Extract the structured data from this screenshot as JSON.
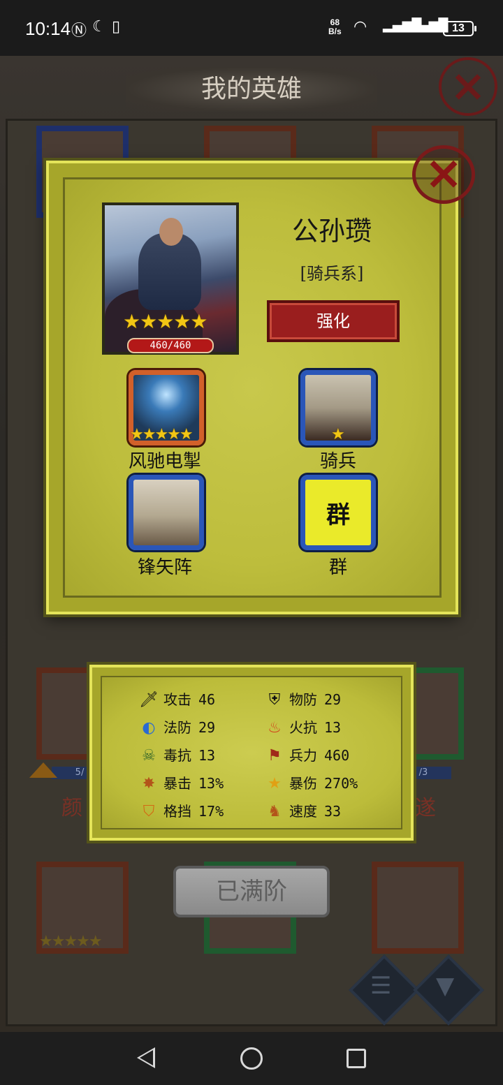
{
  "status_bar": {
    "time": "10:14",
    "net_speed_value": "68",
    "net_speed_unit": "B/s",
    "battery": "13"
  },
  "background": {
    "title": "我的英雄",
    "names": [
      "颜",
      "遂"
    ],
    "bars": [
      "5/",
      "/3"
    ]
  },
  "hero": {
    "name": "公孙瓒",
    "class": "[骑兵系]",
    "stars": "★★★★★",
    "troops": "460/460",
    "strengthen_label": "强化"
  },
  "skills": [
    {
      "label": "风驰电掣",
      "stars": "★★★★★"
    },
    {
      "label": "骑兵",
      "stars": "★"
    },
    {
      "label": "锋矢阵"
    },
    {
      "label": "群",
      "badge": "群"
    }
  ],
  "stats": [
    {
      "label": "攻击",
      "value": "46",
      "icon": "sword-icon"
    },
    {
      "label": "物防",
      "value": "29",
      "icon": "armor-icon"
    },
    {
      "label": "法防",
      "value": "29",
      "icon": "magic-shield-icon"
    },
    {
      "label": "火抗",
      "value": "13",
      "icon": "fire-icon"
    },
    {
      "label": "毒抗",
      "value": "13",
      "icon": "poison-icon"
    },
    {
      "label": "兵力",
      "value": "460",
      "icon": "banner-icon"
    },
    {
      "label": "暴击",
      "value": "13%",
      "icon": "crit-icon"
    },
    {
      "label": "暴伤",
      "value": "270%",
      "icon": "star-burst-icon"
    },
    {
      "label": "格挡",
      "value": "17%",
      "icon": "shield-icon"
    },
    {
      "label": "速度",
      "value": "33",
      "icon": "horse-icon"
    }
  ],
  "maxed_label": "已满阶",
  "colors": {
    "panel_yellow": "#bdbd3c",
    "panel_border": "#e4e45a",
    "strengthen_red": "#9a1e1e",
    "star_gold": "#f2c614",
    "skill_blue": "#2a56b8",
    "skill_orange": "#d2602a"
  }
}
